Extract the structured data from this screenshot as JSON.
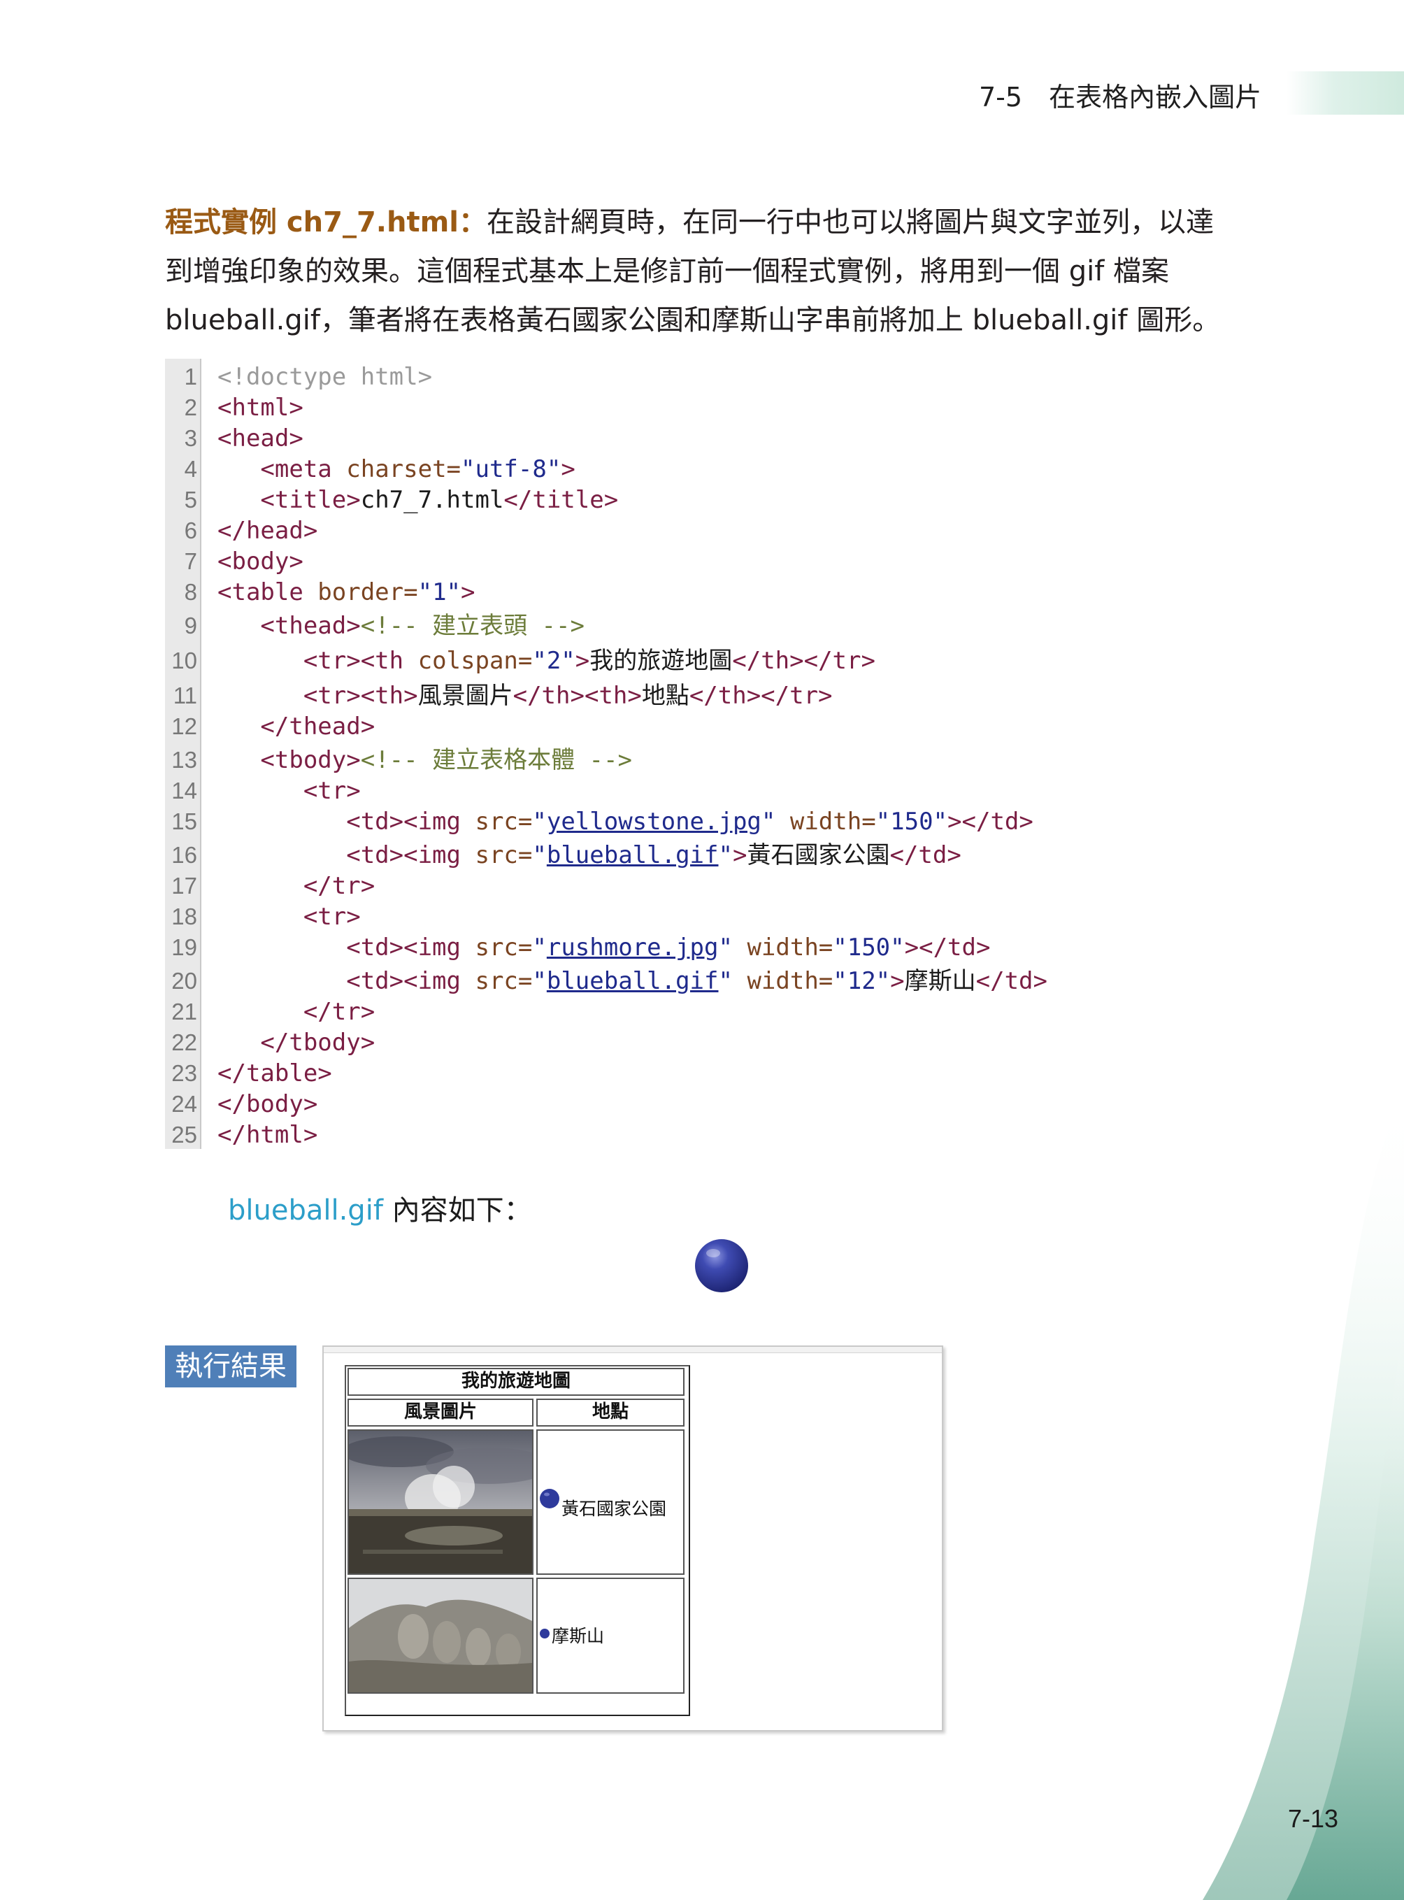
{
  "header": {
    "section": "7-5",
    "title": "在表格內嵌入圖片",
    "page_number": "7-13"
  },
  "intro": {
    "label": "程式實例 ch7_7.html：",
    "line1": "在設計網頁時，在同一行中也可以將圖片與文字並列，以達",
    "line2": "到增強印象的效果。這個程式基本上是修訂前一個程式實例，將用到一個 gif 檔案",
    "line3": "blueball.gif，筆者將在表格黃石國家公園和摩斯山字串前將加上 blueball.gif 圖形。"
  },
  "code": {
    "line_numbers": [
      "1",
      "2",
      "3",
      "4",
      "5",
      "6",
      "7",
      "8",
      "9",
      "10",
      "11",
      "12",
      "13",
      "14",
      "15",
      "16",
      "17",
      "18",
      "19",
      "20",
      "21",
      "22",
      "23",
      "24",
      "25"
    ],
    "l1": "<!doctype html>",
    "l2": "<html>",
    "l3": "<head>",
    "l4_open": "<meta ",
    "l4_attr": "charset=",
    "l4_val": "\"utf-8\"",
    "l4_close": ">",
    "l5_open": "<title>",
    "l5_text": "ch7_7.html",
    "l5_close": "</title>",
    "l6": "</head>",
    "l7": "<body>",
    "l8_open": "<table ",
    "l8_attr": "border=",
    "l8_val": "\"1\"",
    "l8_close": ">",
    "l9_tag": "<thead>",
    "l9_comment": "<!-- 建立表頭 -->",
    "l10_tags": "<tr><th ",
    "l10_attr": "colspan=",
    "l10_val": "\"2\"",
    "l10_gt": ">",
    "l10_text": "我的旅遊地圖",
    "l10_close": "</th></tr>",
    "l11_a": "<tr><th>",
    "l11_t1": "風景圖片",
    "l11_b": "</th><th>",
    "l11_t2": "地點",
    "l11_c": "</th></tr>",
    "l12": "</thead>",
    "l13_tag": "<tbody>",
    "l13_comment": "<!-- 建立表格本體 -->",
    "l14": "<tr>",
    "l15_a": "<td><img ",
    "l15_attr": "src=",
    "l15_q1": "\"",
    "l15_link": "yellowstone.jpg",
    "l15_q2": "\" ",
    "l15_attr2": "width=",
    "l15_val2": "\"150\"",
    "l15_close": "></td>",
    "l16_a": "<td><img ",
    "l16_attr": "src=",
    "l16_q1": "\"",
    "l16_link": "blueball.gif",
    "l16_q2": "\"",
    "l16_gt": ">",
    "l16_text": "黃石國家公園",
    "l16_close": "</td>",
    "l17": "</tr>",
    "l18": "<tr>",
    "l19_a": "<td><img ",
    "l19_attr": "src=",
    "l19_q1": "\"",
    "l19_link": "rushmore.jpg",
    "l19_q2": "\" ",
    "l19_attr2": "width=",
    "l19_val2": "\"150\"",
    "l19_close": "></td>",
    "l20_a": "<td><img ",
    "l20_attr": "src=",
    "l20_q1": "\"",
    "l20_link": "blueball.gif",
    "l20_q2": "\" ",
    "l20_attr2": "width=",
    "l20_val2": "\"12\"",
    "l20_gt": ">",
    "l20_text": "摩斯山",
    "l20_close": "</td>",
    "l21": "</tr>",
    "l22": "</tbody>",
    "l23": "</table>",
    "l24": "</body>",
    "l25": "</html>"
  },
  "caption": {
    "filename": "blueball.gif",
    "text": " 內容如下："
  },
  "result": {
    "label": "執行結果",
    "table_title": "我的旅遊地圖",
    "col1_header": "風景圖片",
    "col2_header": "地點",
    "row1_place": "黃石國家公園",
    "row2_place": "摩斯山"
  },
  "colors": {
    "accent_brown": "#9a5a14",
    "result_label_blue": "#4f7fb8",
    "filename_cyan": "#2c9ec9",
    "ball_blue": "#2e3a9c"
  }
}
